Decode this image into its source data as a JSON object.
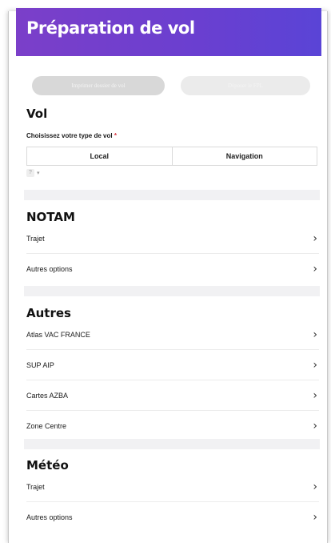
{
  "header": {
    "title": "Préparation de vol",
    "gradient": [
      "#7b3fc9",
      "#5a44d6"
    ]
  },
  "actions": {
    "print_label": "Imprimer dossier de vol",
    "submit_label": "Déposer le FPL"
  },
  "vol": {
    "heading": "Vol",
    "type_label": "Choisissez votre type de vol",
    "required_mark": "*",
    "options": [
      "Local",
      "Navigation"
    ],
    "hint_icon": "?",
    "hint_caret": "▾"
  },
  "notam": {
    "heading": "NOTAM",
    "items": [
      {
        "label": "Trajet",
        "icon": "chevron-right-icon"
      },
      {
        "label": "Autres options",
        "icon": "chevron-right-icon"
      }
    ]
  },
  "autres": {
    "heading": "Autres",
    "items": [
      {
        "label": "Atlas VAC FRANCE",
        "icon": "chevron-right-icon"
      },
      {
        "label": "SUP AIP",
        "icon": "chevron-right-icon"
      },
      {
        "label": "Cartes AZBA",
        "icon": "chevron-right-icon"
      },
      {
        "label": "Zone Centre",
        "icon": "chevron-right-icon"
      }
    ]
  },
  "meteo": {
    "heading": "Météo",
    "items": [
      {
        "label": "Trajet",
        "icon": "chevron-right-icon"
      },
      {
        "label": "Autres options",
        "icon": "chevron-right-icon"
      }
    ]
  },
  "chevron_glyph": "›"
}
